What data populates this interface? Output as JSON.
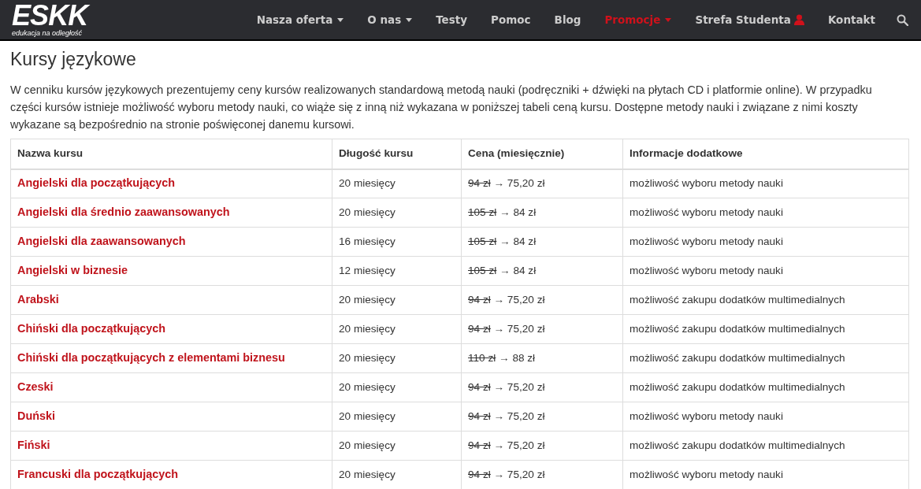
{
  "logo": {
    "name": "ESKK",
    "tagline": "edukacja na odległość"
  },
  "nav": [
    {
      "label": "Nasza oferta",
      "caret": true,
      "selected": false,
      "user_icon": false
    },
    {
      "label": "O nas",
      "caret": true,
      "selected": false,
      "user_icon": false
    },
    {
      "label": "Testy",
      "caret": false,
      "selected": false,
      "user_icon": false
    },
    {
      "label": "Pomoc",
      "caret": false,
      "selected": false,
      "user_icon": false
    },
    {
      "label": "Blog",
      "caret": false,
      "selected": false,
      "user_icon": false
    },
    {
      "label": "Promocje",
      "caret": true,
      "selected": true,
      "user_icon": false
    },
    {
      "label": "Strefa Studenta",
      "caret": false,
      "selected": false,
      "user_icon": true
    },
    {
      "label": "Kontakt",
      "caret": false,
      "selected": false,
      "user_icon": false
    }
  ],
  "heading": "Kursy językowe",
  "intro": "W cenniku kursów językowych prezentujemy ceny kursów realizowanych standardową metodą nauki (podręczniki + dźwięki na płytach CD i platformie online). W przypadku części kursów istnieje możliwość wyboru metody nauki, co wiąże się z inną niż wykazana w poniższej tabeli ceną kursu. Dostępne metody nauki i związane z nimi koszty wykazane są bezpośrednio na stronie poświęconej danemu kursowi.",
  "table": {
    "columns": [
      "Nazwa kursu",
      "Długość kursu",
      "Cena (miesięcznie)",
      "Informacje dodatkowe"
    ],
    "rows": [
      {
        "name": "Angielski dla początkujących",
        "length": "20 miesięcy",
        "old_price": "94 zł",
        "new_price": "→ 75,20 zł",
        "info": "możliwość wyboru metody nauki"
      },
      {
        "name": "Angielski dla średnio zaawansowanych",
        "length": "20 miesięcy",
        "old_price": "105 zł",
        "new_price": "→ 84 zł",
        "info": "możliwość wyboru metody nauki"
      },
      {
        "name": "Angielski dla zaawansowanych",
        "length": "16 miesięcy",
        "old_price": "105 zł",
        "new_price": "→ 84 zł",
        "info": "możliwość wyboru metody nauki"
      },
      {
        "name": "Angielski w biznesie",
        "length": "12 miesięcy",
        "old_price": "105 zł",
        "new_price": "→ 84 zł",
        "info": "możliwość wyboru metody nauki"
      },
      {
        "name": "Arabski",
        "length": "20 miesięcy",
        "old_price": "94 zł",
        "new_price": "→ 75,20 zł",
        "info": "możliwość zakupu dodatków multimedialnych"
      },
      {
        "name": "Chiński dla początkujących",
        "length": "20 miesięcy",
        "old_price": "94 zł",
        "new_price": "→ 75,20 zł",
        "info": "możliwość zakupu dodatków multimedialnych"
      },
      {
        "name": "Chiński dla początkujących z elementami biznesu",
        "length": "20 miesięcy",
        "old_price": "110 zł",
        "new_price": "→ 88 zł",
        "info": "możliwość zakupu dodatków multimedialnych"
      },
      {
        "name": "Czeski",
        "length": "20 miesięcy",
        "old_price": "94 zł",
        "new_price": "→ 75,20 zł",
        "info": "możliwość zakupu dodatków multimedialnych"
      },
      {
        "name": "Duński",
        "length": "20 miesięcy",
        "old_price": "94 zł",
        "new_price": "→ 75,20 zł",
        "info": "możliwość wyboru metody nauki"
      },
      {
        "name": "Fiński",
        "length": "20 miesięcy",
        "old_price": "94 zł",
        "new_price": "→ 75,20 zł",
        "info": "możliwość zakupu dodatków multimedialnych"
      },
      {
        "name": "Francuski dla początkujących",
        "length": "20 miesięcy",
        "old_price": "94 zł",
        "new_price": "→ 75,20 zł",
        "info": "możliwość wyboru metody nauki"
      }
    ]
  }
}
